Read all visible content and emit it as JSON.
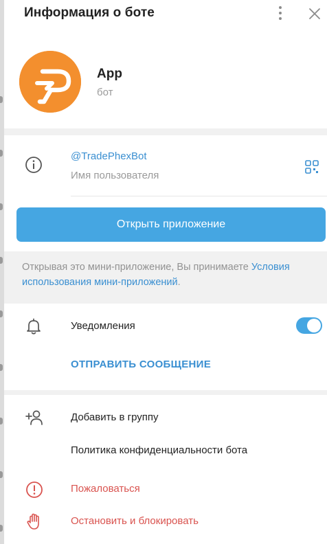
{
  "header": {
    "title": "Информация о боте"
  },
  "bot": {
    "name": "App",
    "type": "бот",
    "avatar_color": "#f38f2e"
  },
  "info": {
    "username": "@TradePhexBot",
    "username_label": "Имя пользователя"
  },
  "open_button": {
    "label": "Открыть приложение",
    "color": "#45a6e2"
  },
  "notice": {
    "text": "Открывая это мини-приложение, Вы принимаете",
    "link": "Условия использования мини-приложений",
    "suffix": "."
  },
  "notifications": {
    "label": "Уведомления",
    "enabled": true
  },
  "send_message": {
    "label": "ОТПРАВИТЬ СООБЩЕНИЕ"
  },
  "actions": {
    "add_to_group": "Добавить в группу",
    "privacy_policy": "Политика конфиденциальности бота",
    "report": "Пожаловаться",
    "block": "Остановить и блокировать"
  },
  "colors": {
    "accent": "#45a6e2",
    "link": "#3a8fd1",
    "danger": "#d9534f"
  },
  "icons": [
    "kebab-icon",
    "close-icon",
    "info-icon",
    "qr-code-icon",
    "bell-icon",
    "add-user-icon",
    "report-icon",
    "stop-hand-icon"
  ]
}
